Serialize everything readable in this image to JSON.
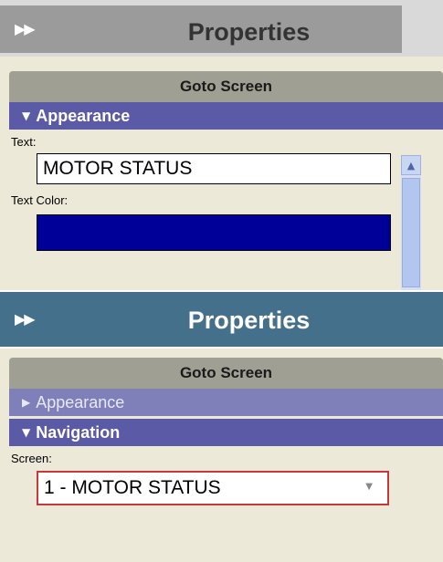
{
  "panels": [
    {
      "header": {
        "title": "Properties",
        "toggle_icon": "double-chevron-right-icon"
      },
      "group": {
        "title": "Goto Screen"
      },
      "sections": [
        {
          "label": "Appearance",
          "state": "expanded"
        }
      ],
      "fields": {
        "text_label": "Text:",
        "text_value": "MOTOR STATUS",
        "color_label": "Text Color:",
        "color_value": "#000099"
      }
    },
    {
      "header": {
        "title": "Properties",
        "toggle_icon": "double-chevron-right-icon"
      },
      "group": {
        "title": "Goto Screen"
      },
      "sections": [
        {
          "label": "Appearance",
          "state": "collapsed"
        },
        {
          "label": "Navigation",
          "state": "expanded"
        }
      ],
      "fields": {
        "screen_label": "Screen:",
        "screen_value": "1 - MOTOR STATUS"
      }
    }
  ],
  "colors": {
    "header_blue": "#44708c",
    "section_open": "#5a5aa6",
    "section_closed": "#7f7fba",
    "focus_border": "#c8383a"
  }
}
